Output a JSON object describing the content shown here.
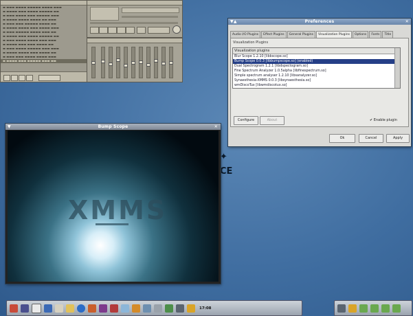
{
  "preferences": {
    "title": "Preferences",
    "tabs": [
      "Audio I/O Plugins",
      "Effect Plugins",
      "General Plugins",
      "Visualization Plugins",
      "Options",
      "Fonts",
      "Title"
    ],
    "active_tab": "Visualization Plugins",
    "group_label": "Visualization Plugins",
    "list_header": "Visualization plugins",
    "plugins": [
      "Blur Scope 1.2.10   [libbscope.so]",
      "Bump Scope 0.0.3   [libbumpscope.so] (enabled)",
      "Dual Spectrogram 1.2.1   [libdspectogram.so]",
      "Fine Spectrum Analyzer 1.0.5alpha   [libfinespectrum.so]",
      "Simple spectrum analyser 1.2.10   [libsanalyzer.so]",
      "Synaesthesia-XMMS 0.0.3   [libsynaesthesia.so]",
      "wmDiscoTux   [libwmdiscotux.so]"
    ],
    "selected_index": 1,
    "configure_label": "Configure",
    "about_label": "About",
    "enable_plugin_label": "Enable plugin",
    "enable_plugin_checked": true,
    "ok_label": "Ok",
    "cancel_label": "Cancel",
    "apply_label": "Apply"
  },
  "bump_scope": {
    "title": "Bump Scope",
    "logo_text": "XMMS"
  },
  "desktop_fragments": {
    "letters": "CE"
  },
  "taskbar": {
    "clock": "17:08"
  },
  "colors": {
    "desktop_bg": "#3f6da0",
    "selection": "#253f87",
    "pref_titlebar": "#7b97bb",
    "bump_titlebar": "#97a0ac"
  }
}
